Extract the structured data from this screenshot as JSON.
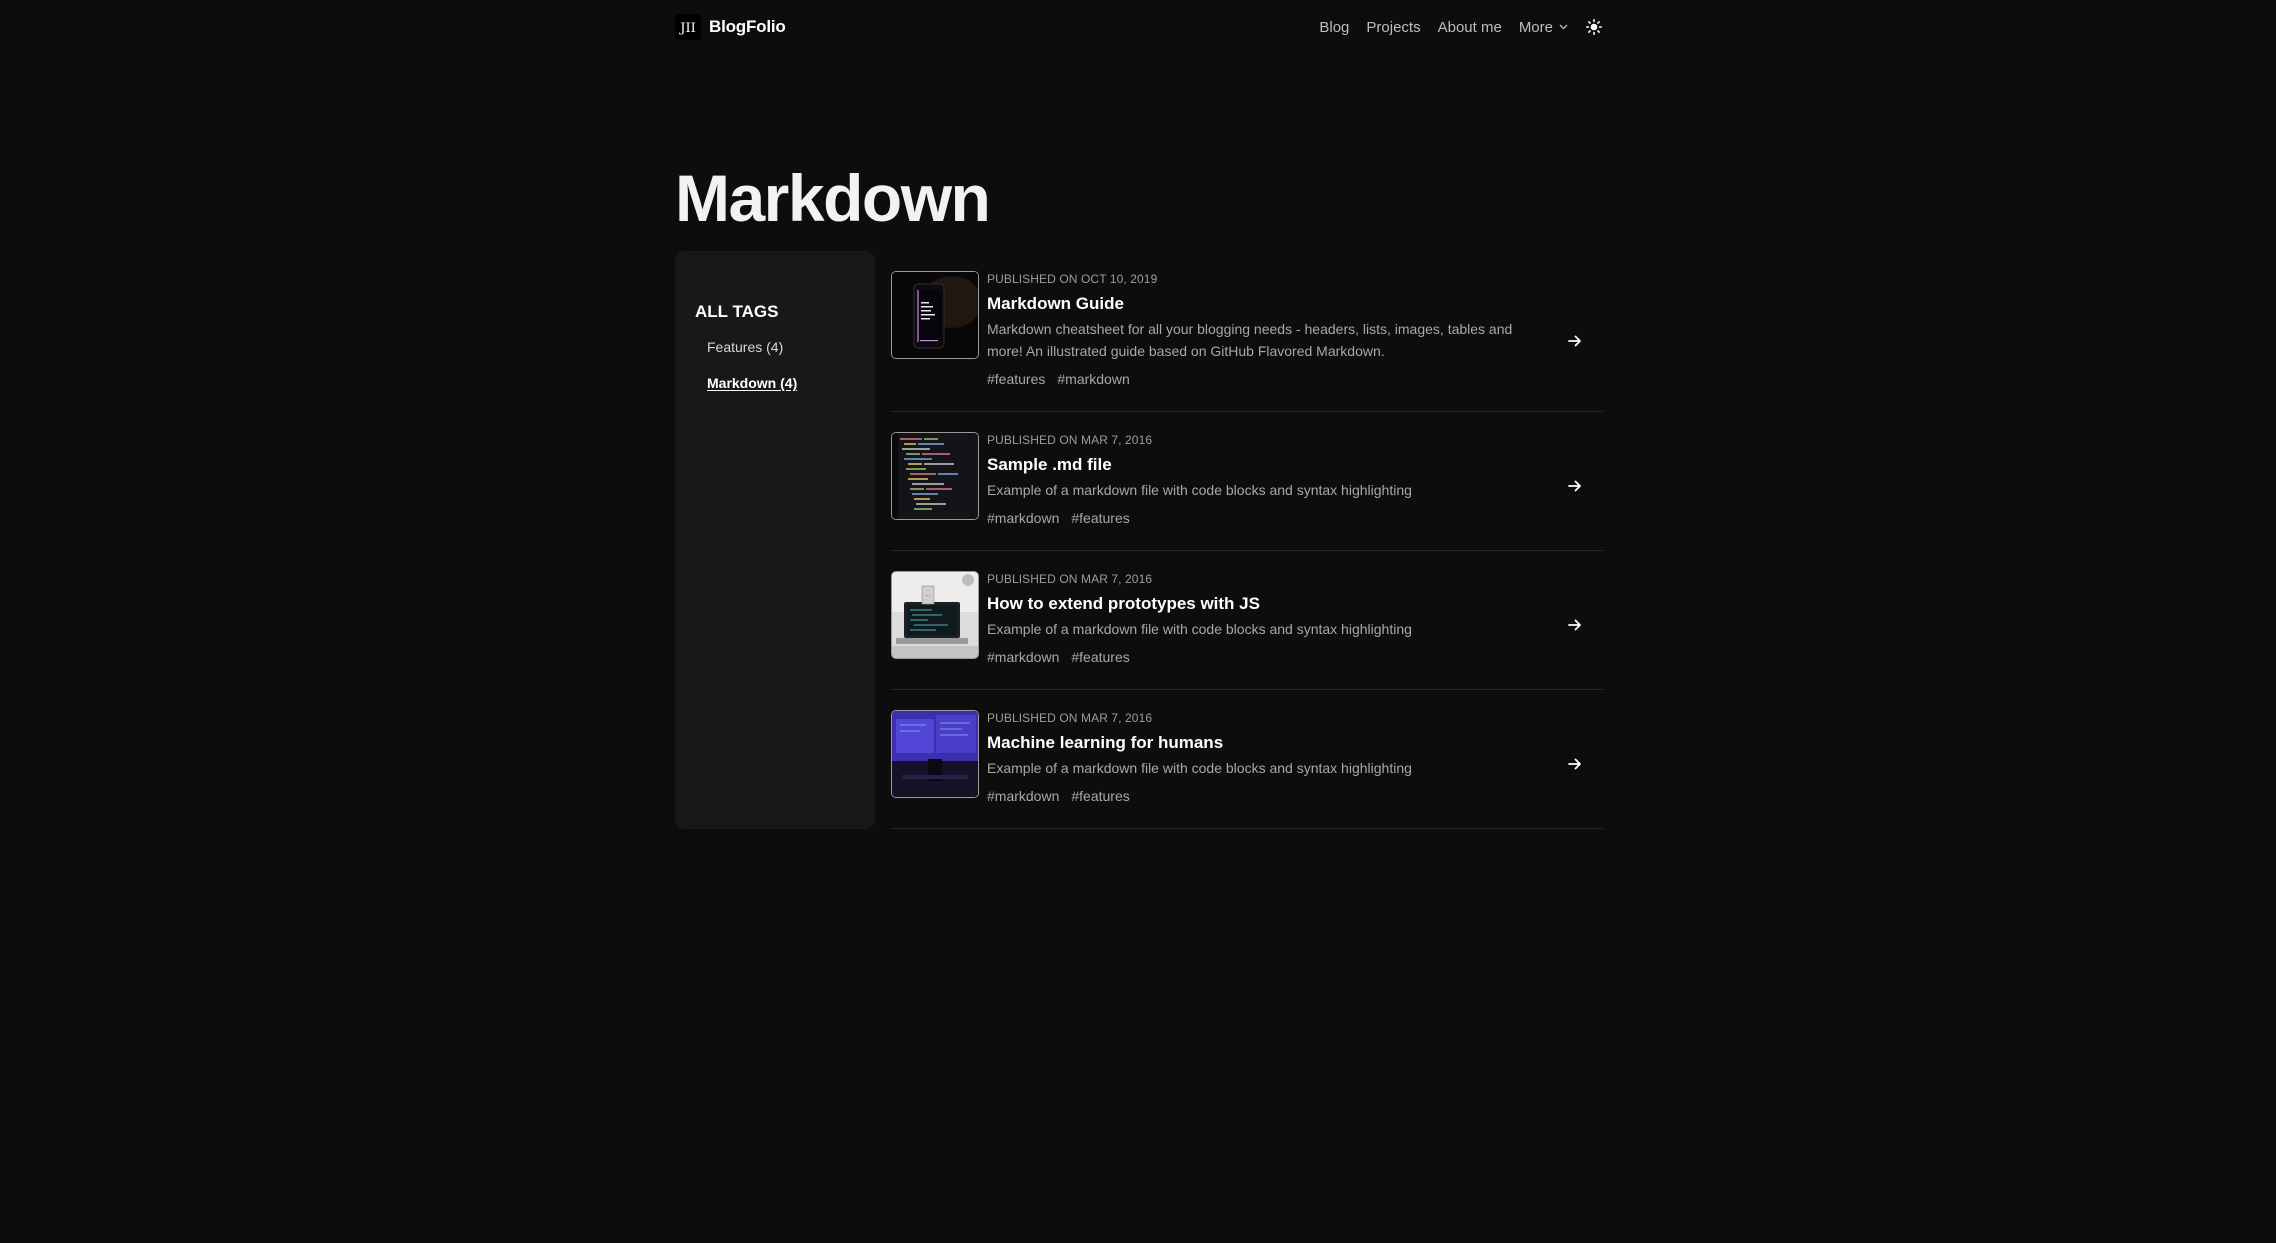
{
  "header": {
    "logo_text": "JII",
    "brand": "BlogFolio",
    "nav": [
      {
        "label": "Blog"
      },
      {
        "label": "Projects"
      },
      {
        "label": "About me"
      }
    ],
    "more_label": "More"
  },
  "page": {
    "title": "Markdown"
  },
  "sidebar": {
    "heading": "ALL TAGS",
    "tags": [
      {
        "label": "Features (4)",
        "active": false
      },
      {
        "label": "Markdown (4)",
        "active": true
      }
    ]
  },
  "posts": [
    {
      "date": "PUBLISHED ON OCT 10, 2019",
      "title": "Markdown Guide",
      "excerpt": "Markdown cheatsheet for all your blogging needs - headers, lists, images, tables and more! An illustrated guide based on GitHub Flavored Markdown.",
      "tags": [
        "#features",
        "#markdown"
      ]
    },
    {
      "date": "PUBLISHED ON MAR 7, 2016",
      "title": "Sample .md file",
      "excerpt": "Example of a markdown file with code blocks and syntax highlighting",
      "tags": [
        "#markdown",
        "#features"
      ]
    },
    {
      "date": "PUBLISHED ON MAR 7, 2016",
      "title": "How to extend prototypes with JS",
      "excerpt": "Example of a markdown file with code blocks and syntax highlighting",
      "tags": [
        "#markdown",
        "#features"
      ]
    },
    {
      "date": "PUBLISHED ON MAR 7, 2016",
      "title": "Machine learning for humans",
      "excerpt": "Example of a markdown file with code blocks and syntax highlighting",
      "tags": [
        "#markdown",
        "#features"
      ]
    }
  ],
  "colors": {
    "background": "#0d0d0d",
    "sidebar": "#18181a",
    "text": "#ffffff",
    "muted": "#a8a8a8"
  },
  "icons": {
    "more": "chevron-down-icon",
    "theme": "sun-icon",
    "post_link": "arrow-right-icon"
  }
}
